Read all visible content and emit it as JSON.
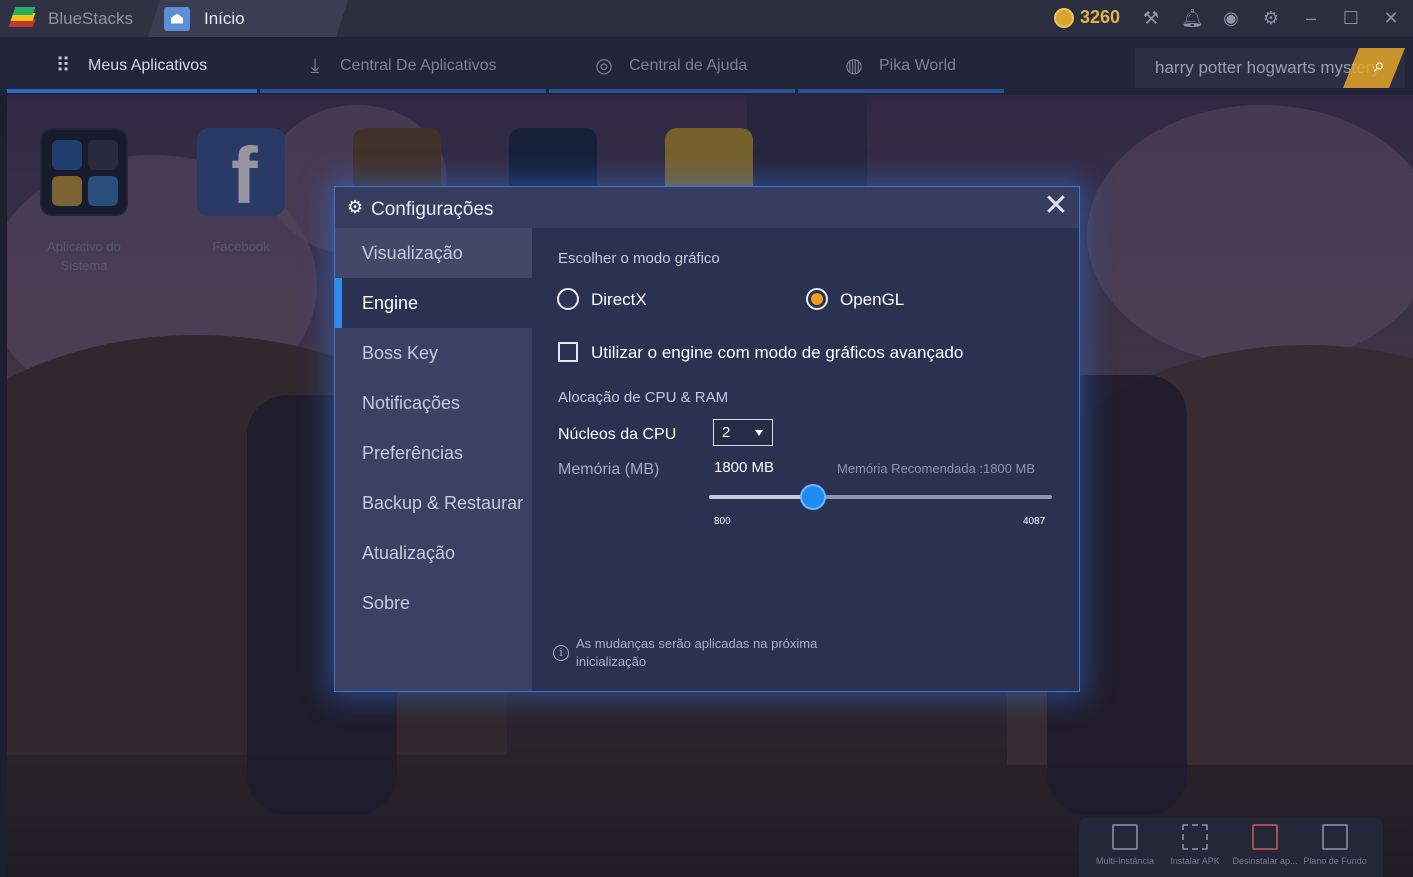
{
  "titlebar": {
    "app_name": "BlueStacks",
    "tab_label": "Início",
    "coins": "3260",
    "icons": [
      "hammer-icon",
      "bell-icon",
      "account-icon",
      "gear-icon",
      "minimize-icon",
      "maximize-icon",
      "close-icon"
    ]
  },
  "nav": {
    "items": [
      {
        "label": "Meus Aplicativos",
        "icon": "grid-icon"
      },
      {
        "label": "Central De Aplicativos",
        "icon": "download-icon"
      },
      {
        "label": "Central de Ajuda",
        "icon": "lifebuoy-icon"
      },
      {
        "label": "Pika World",
        "icon": "globe-icon"
      }
    ],
    "search_value": "harry potter hogwarts mystery"
  },
  "desktop": {
    "apps": [
      {
        "label": "Aplicativo do Sistema"
      },
      {
        "label": "Facebook"
      }
    ]
  },
  "tools": [
    {
      "label": "Multi-Instância"
    },
    {
      "label": "Instalar APK"
    },
    {
      "label": "Desinstalar ap..."
    },
    {
      "label": "Plano de Fundo"
    }
  ],
  "dialog": {
    "title": "Configurações",
    "sidebar": [
      "Visualização",
      "Engine",
      "Boss Key",
      "Notificações",
      "Preferências",
      "Backup & Restaurar",
      "Atualização",
      "Sobre"
    ],
    "active_index": 1,
    "graphics_mode_label": "Escolher o modo gráfico",
    "option_directx": "DirectX",
    "option_opengl": "OpenGL",
    "selected_mode": "OpenGL",
    "advanced_label": "Utilizar o engine com modo de gráficos avançado",
    "advanced_checked": false,
    "cpu_ram_label": "Alocação de CPU & RAM",
    "cpu_label": "Núcleos da CPU",
    "cpu_value": "2",
    "memory_label": "Memória (MB)",
    "memory_value": "1800 MB",
    "memory_recommended": "Memória Recomendada :1800 MB",
    "slider_min": "800",
    "slider_max": "4087",
    "slider_current": 1800,
    "note": "As mudanças serão aplicadas na próxima inicialização",
    "note_line1": "As mudanças serão aplicadas na próxima",
    "note_line2": "inicialização"
  },
  "colors": {
    "accent": "#2f8df0",
    "radio_selected": "#f29b1f",
    "coins": "#e0b34a"
  }
}
